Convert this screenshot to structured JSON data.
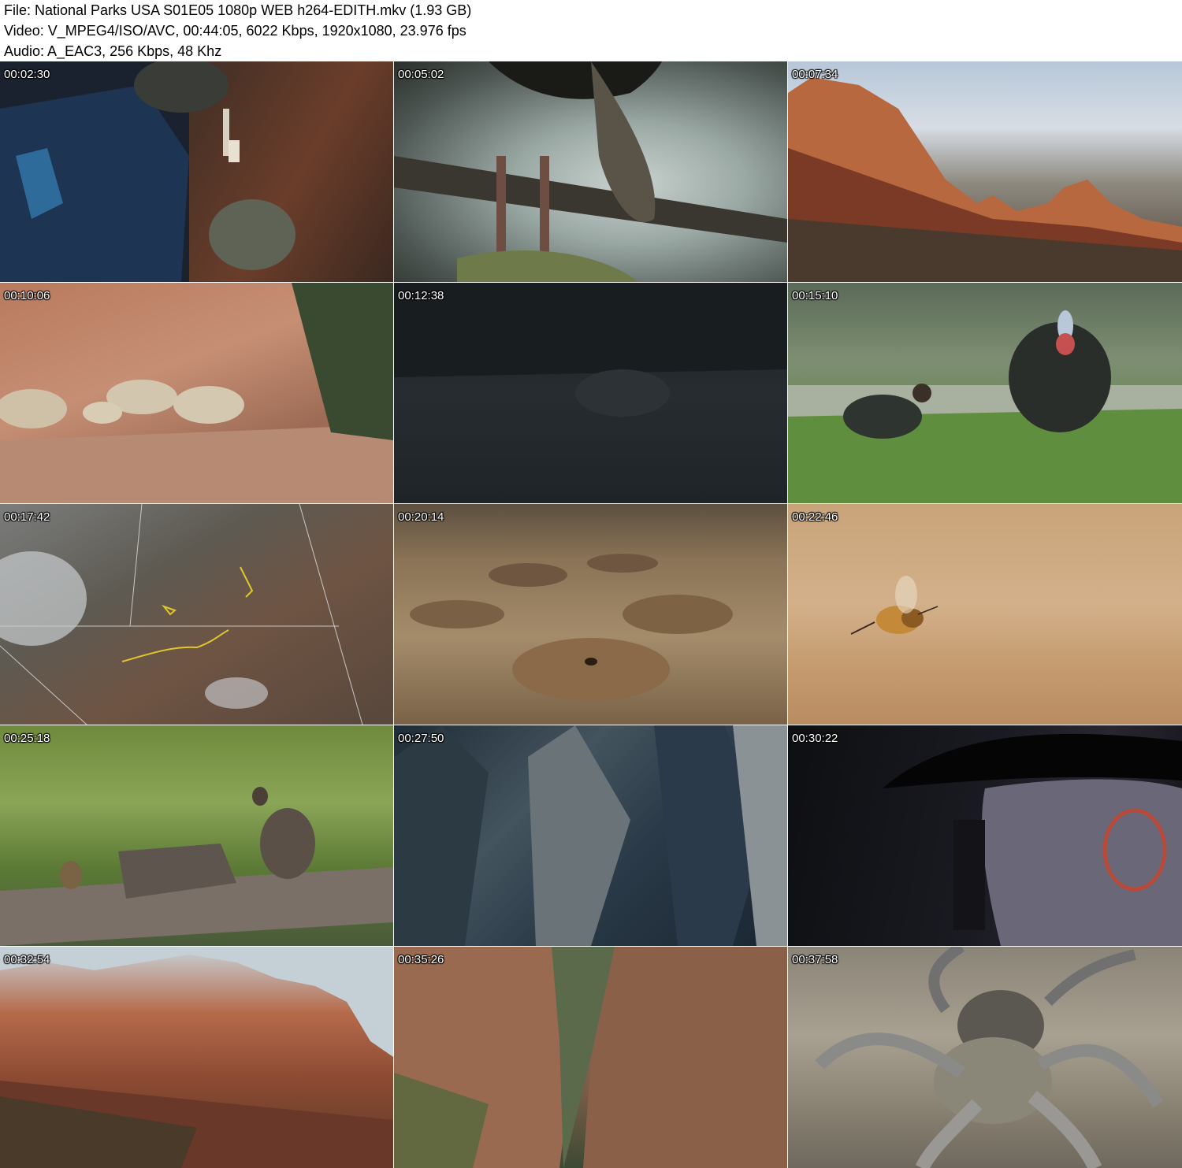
{
  "header": {
    "file_line": "File: National Parks USA S01E05 1080p WEB h264-EDITH.mkv (1.93 GB)",
    "video_line": "Video: V_MPEG4/ISO/AVC, 00:44:05, 6022 Kbps, 1920x1080, 23.976 fps",
    "audio_line": "Audio: A_EAC3, 256 Kbps, 48 Khz"
  },
  "thumbnails": [
    {
      "timestamp": "00:02:30"
    },
    {
      "timestamp": "00:05:02"
    },
    {
      "timestamp": "00:07:34"
    },
    {
      "timestamp": "00:10:06"
    },
    {
      "timestamp": "00:12:38"
    },
    {
      "timestamp": "00:15:10"
    },
    {
      "timestamp": "00:17:42"
    },
    {
      "timestamp": "00:20:14"
    },
    {
      "timestamp": "00:22:46"
    },
    {
      "timestamp": "00:25:18"
    },
    {
      "timestamp": "00:27:50"
    },
    {
      "timestamp": "00:30:22"
    },
    {
      "timestamp": "00:32:54"
    },
    {
      "timestamp": "00:35:26"
    },
    {
      "timestamp": "00:37:58"
    }
  ]
}
